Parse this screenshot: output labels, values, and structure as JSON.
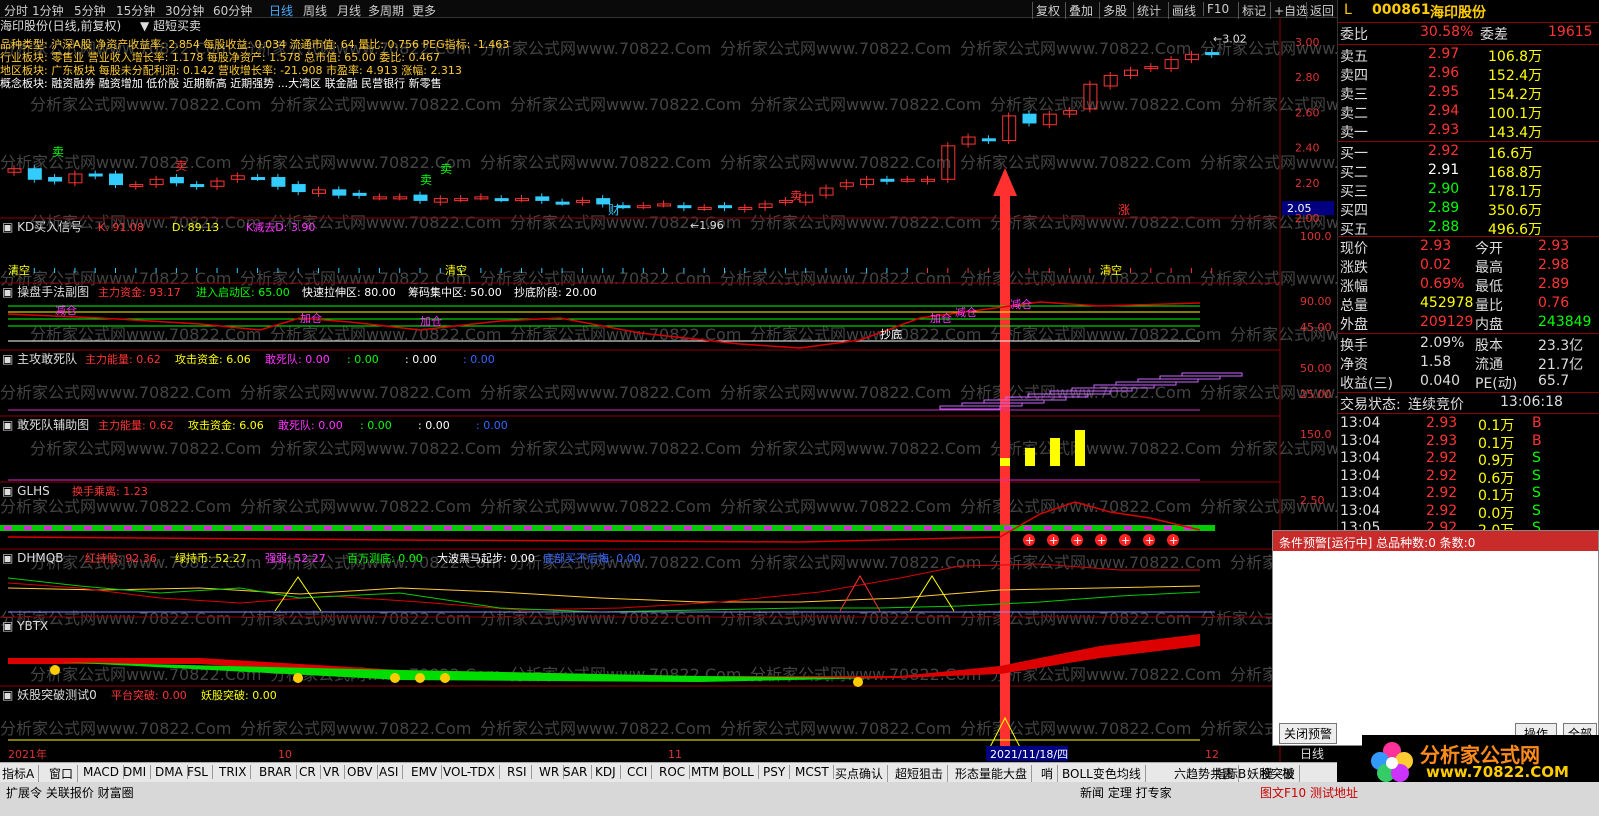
{
  "toolbar": {
    "items": [
      "分时",
      "1分钟",
      "5分钟",
      "15分钟",
      "30分钟",
      "60分钟",
      "日线",
      "周线",
      "月线",
      "多周期",
      "更多"
    ],
    "right": [
      "复权",
      "叠加",
      "多股",
      "统计",
      "画线",
      "F10",
      "标记",
      "+自选",
      "返回"
    ]
  },
  "stock": {
    "code": "000861",
    "name": "海印股份",
    "L": "L",
    "chart_title": "海印股份(日线,前复权)",
    "mode": "超短买卖"
  },
  "info": {
    "lines": [
      "品种类型: 沪深A股   净资产收益率: 2.854   每股收益: 0.034   流通市值: 64   量比: 0.756   PEG指标: -1.463",
      "行业板块: 零售业   营业收入增长率: 1.178   每股净资产: 1.578   总市值: 65.00   委比: 0.467",
      "地区板块: 广东板块   每股未分配利润: 0.142   营收增长率: -21.908   市盈率: 4.913   涨幅: 2.313",
      "概念板块: 融资融券 融资增加 低价股 近期新高 近期强势 ...大湾区 联金融 民营银行 新零售"
    ]
  },
  "price_axis": [
    "3.00",
    "2.80",
    "2.60",
    "2.40",
    "2.20",
    "2.05",
    "2.00"
  ],
  "price_current": "3.02",
  "price_low": "1.96",
  "panels": [
    {
      "name": "KD买入信号",
      "vals": [
        "K: 91.08",
        "D: 89.13",
        "K减去D: 3.90"
      ],
      "axis": [
        "100.0"
      ],
      "labels": [
        "清空",
        "清空",
        "清空"
      ]
    },
    {
      "name": "操盘手法副图",
      "vals": [
        "主力资金: 93.17",
        "进入启动区: 65.00",
        "快速拉伸区: 80.00",
        "筹码集中区: 50.00",
        "抄底阶段: 20.00"
      ],
      "axis": [
        "90.00",
        "45.00"
      ],
      "labels": [
        "减仓",
        "加仓",
        "加仓",
        "抄底",
        "加仓",
        "减仓",
        "减仓"
      ]
    },
    {
      "name": "主攻敢死队",
      "vals": [
        "主力能量: 0.62",
        "攻击资金: 6.06",
        "敢死队: 0.00",
        ": 0.00",
        ": 0.00",
        ": 0.00"
      ],
      "axis": [
        "50.00",
        "25.00"
      ]
    },
    {
      "name": "敢死队辅助图",
      "vals": [
        "主力能量: 0.62",
        "攻击资金: 6.06",
        "敢死队: 0.00",
        ": 0.00",
        ": 0.00",
        ": 0.00"
      ],
      "axis": [
        "150.0"
      ]
    },
    {
      "name": "GLHS",
      "vals": [
        "换手乘离: 1.23"
      ],
      "axis": [
        "2.50"
      ]
    },
    {
      "name": "DHMQB",
      "vals": [
        "红持股: 92.36",
        "绿持币: 52.27",
        "强弱: 52.27",
        "百万测底: 0.00",
        "大波黑马起步: 0.00",
        "底部买不后悔: 0.00"
      ],
      "axis": []
    },
    {
      "name": "YBTX",
      "vals": [],
      "axis": []
    },
    {
      "name": "妖股突破测试0",
      "vals": [
        "平台突破: 0.00",
        "妖股突破: 0.00"
      ],
      "axis": []
    }
  ],
  "xaxis": {
    "labels": [
      "2021年",
      "10",
      "11",
      "12"
    ],
    "cursor": "2021/11/18/四",
    "period": "日线"
  },
  "signals": {
    "buy": "卖",
    "sell": "买",
    "cai": "财",
    "zhang": "涨"
  },
  "quote": {
    "weibi": {
      "label": "委比",
      "value": "30.58%",
      "label2": "委差",
      "value2": "19615"
    },
    "asks": [
      {
        "l": "卖五",
        "p": "2.97",
        "v": "106.8万"
      },
      {
        "l": "卖四",
        "p": "2.96",
        "v": "152.4万"
      },
      {
        "l": "卖三",
        "p": "2.95",
        "v": "154.2万"
      },
      {
        "l": "卖二",
        "p": "2.94",
        "v": "100.1万"
      },
      {
        "l": "卖一",
        "p": "2.93",
        "v": "143.4万"
      }
    ],
    "bids": [
      {
        "l": "买一",
        "p": "2.92",
        "v": "16.6万"
      },
      {
        "l": "买二",
        "p": "2.91",
        "v": "168.8万"
      },
      {
        "l": "买三",
        "p": "2.90",
        "v": "178.1万"
      },
      {
        "l": "买四",
        "p": "2.89",
        "v": "350.6万"
      },
      {
        "l": "买五",
        "p": "2.88",
        "v": "496.6万"
      }
    ],
    "stats": [
      {
        "l": "现价",
        "v": "2.93",
        "l2": "今开",
        "v2": "2.93"
      },
      {
        "l": "涨跌",
        "v": "0.02",
        "l2": "最高",
        "v2": "2.98"
      },
      {
        "l": "涨幅",
        "v": "0.69%",
        "l2": "最低",
        "v2": "2.89"
      },
      {
        "l": "总量",
        "v": "452978",
        "l2": "量比",
        "v2": "0.76"
      },
      {
        "l": "外盘",
        "v": "209129",
        "l2": "内盘",
        "v2": "243849"
      }
    ],
    "stats2": [
      {
        "l": "换手",
        "v": "2.09%",
        "l2": "股本",
        "v2": "23.3亿"
      },
      {
        "l": "净资",
        "v": "1.58",
        "l2": "流通",
        "v2": "21.7亿"
      },
      {
        "l": "收益(三)",
        "v": "0.040",
        "l2": "PE(动)",
        "v2": "65.7"
      }
    ],
    "status": {
      "l": "交易状态:",
      "v": "连续竞价",
      "t": "13:06:18"
    },
    "ticks": [
      {
        "t": "13:04",
        "p": "2.93",
        "v": "0.1万",
        "d": "B"
      },
      {
        "t": "13:04",
        "p": "2.93",
        "v": "0.1万",
        "d": "B"
      },
      {
        "t": "13:04",
        "p": "2.92",
        "v": "0.9万",
        "d": "S"
      },
      {
        "t": "13:04",
        "p": "2.92",
        "v": "0.6万",
        "d": "S"
      },
      {
        "t": "13:04",
        "p": "2.92",
        "v": "0.1万",
        "d": "S"
      },
      {
        "t": "13:04",
        "p": "2.92",
        "v": "0.0万",
        "d": "S"
      },
      {
        "t": "13:05",
        "p": "2.92",
        "v": "2.0万",
        "d": "S"
      }
    ]
  },
  "alert": {
    "header": "条件预警[运行中] 总品种数:0 条数:0",
    "close": "关闭预警",
    "op": "操作",
    "op2": "全部"
  },
  "bottom": {
    "tabs": [
      "指标A",
      "窗口",
      "MACD",
      "DMI",
      "DMA",
      "FSL",
      "TRIX",
      "BRAR",
      "CR",
      "VR",
      "OBV",
      "ASI",
      "EMV",
      "VOL-TDX",
      "RSI",
      "WR",
      "SAR",
      "KDJ",
      "CCI",
      "ROC",
      "MTM",
      "BOLL",
      "PSY",
      "MCST",
      "买点确认",
      "超短狙击",
      "形态量能大盘",
      "哨",
      "BOLL变色均线",
      "六趋势共震",
      "妖股突破"
    ],
    "right": [
      "指标B",
      "模",
      "板"
    ]
  },
  "bottom2": {
    "left": "扩展令 关联报价 财富圈",
    "mid": "新闻 定理 打专家",
    "right": "图文F10 测试地址"
  },
  "watermark": {
    "text": "分析家公式网www.70822.Com",
    "logo": "分析家公式网",
    "url": "www.70822.COM"
  }
}
